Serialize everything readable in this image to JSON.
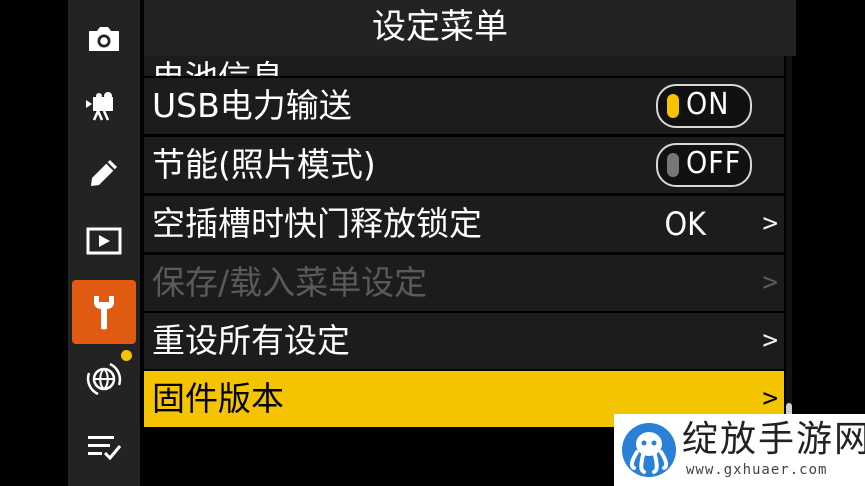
{
  "header": {
    "title": "设定菜单"
  },
  "sidebar": {
    "items": [
      {
        "icon": "camera-icon"
      },
      {
        "icon": "movie-camera-icon"
      },
      {
        "icon": "pencil-icon"
      },
      {
        "icon": "playback-icon"
      },
      {
        "icon": "wrench-icon",
        "active": true
      },
      {
        "icon": "network-globe-icon"
      },
      {
        "icon": "my-menu-icon"
      }
    ],
    "active_color": "#e05a12",
    "notification_dot_color": "#f5c400"
  },
  "menu": {
    "partial_top_label": "电池信息",
    "items": [
      {
        "label": "USB电力输送",
        "toggle": "ON"
      },
      {
        "label": "节能(照片模式)",
        "toggle": "OFF"
      },
      {
        "label": "空插槽时快门释放锁定",
        "value": "OK",
        "chevron": ">"
      },
      {
        "label": "保存/载入菜单设定",
        "chevron": ">",
        "disabled": true
      },
      {
        "label": "重设所有设定",
        "chevron": ">"
      },
      {
        "label": "固件版本",
        "chevron": ">",
        "selected": true
      }
    ],
    "selection_color": "#f5c400"
  },
  "watermark": {
    "name": "绽放手游网",
    "url": "www.gxhuaer.com"
  }
}
